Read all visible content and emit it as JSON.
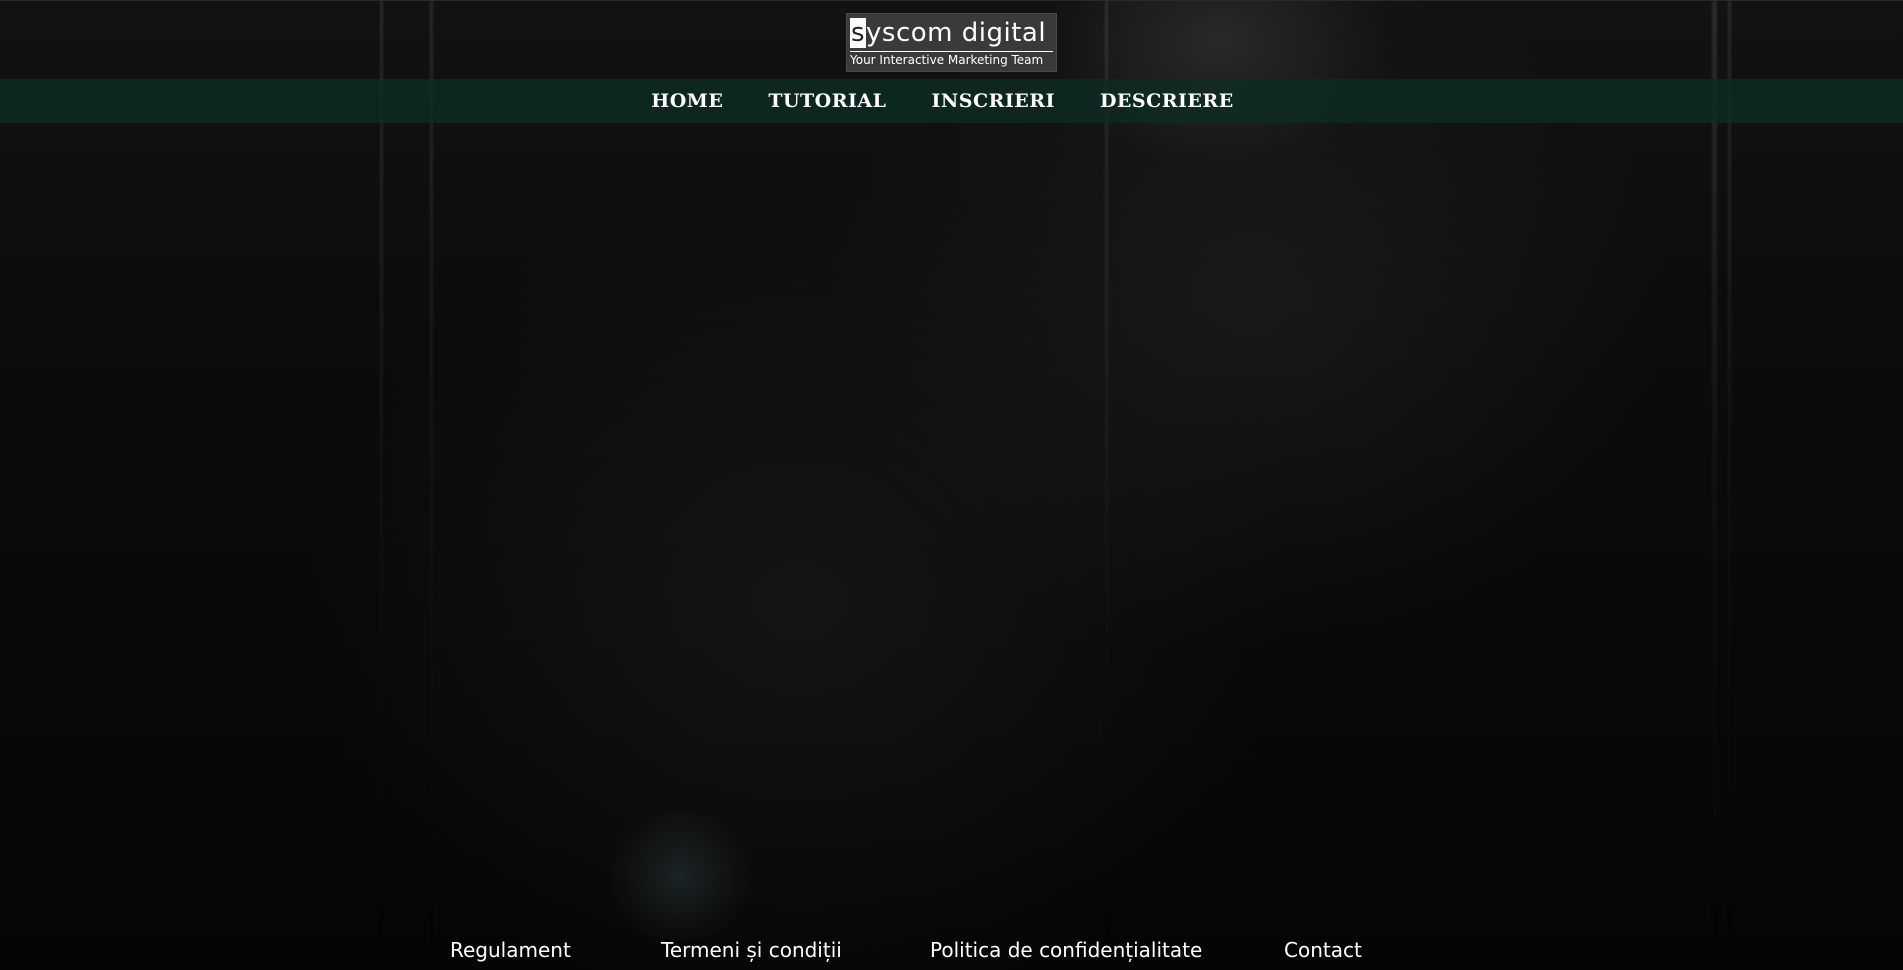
{
  "logo": {
    "title_first": "s",
    "title_rest": "yscom digital",
    "tagline": "Your Interactive Marketing Team"
  },
  "nav": {
    "items": [
      {
        "label": "HOME"
      },
      {
        "label": "TUTORIAL"
      },
      {
        "label": "INSCRIERI"
      },
      {
        "label": "DESCRIERE"
      }
    ]
  },
  "footer": {
    "links": [
      {
        "label": "Regulament"
      },
      {
        "label": "Termeni și condiții"
      },
      {
        "label": "Politica de confidențialitate"
      },
      {
        "label": "Contact"
      }
    ]
  },
  "colors": {
    "page_background": "#050505",
    "navbar_background": "#0c2d24",
    "logo_background": "#3a3a3a",
    "text": "#ffffff"
  }
}
